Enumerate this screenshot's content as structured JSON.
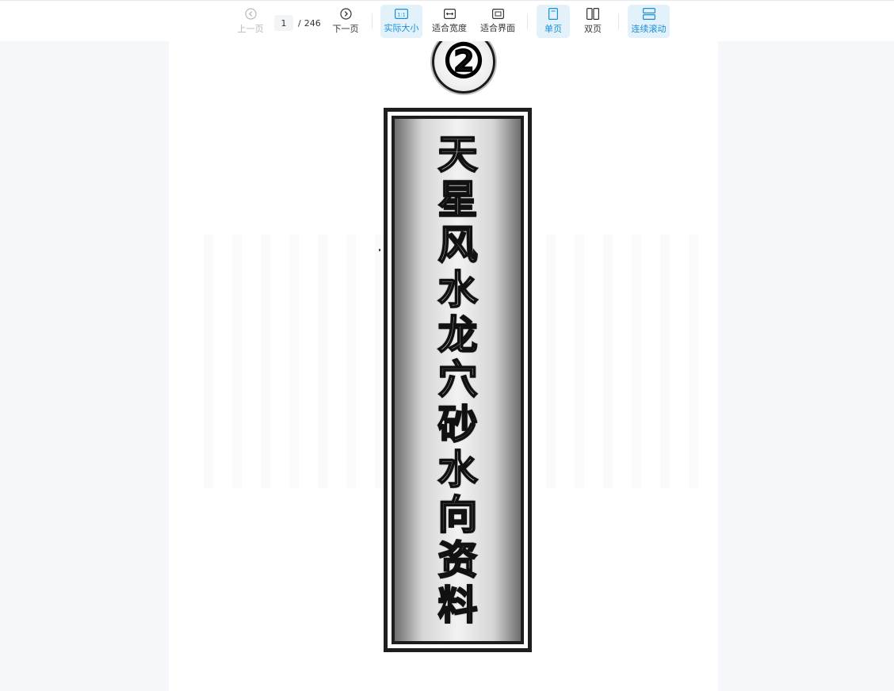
{
  "toolbar": {
    "prev_label": "上一页",
    "next_label": "下一页",
    "current_page": "1",
    "page_separator": "/",
    "total_pages": "246",
    "actual_size_icon_text": "1:1",
    "actual_size_label": "实际大小",
    "fit_width_label": "适合宽度",
    "fit_page_label": "适合界面",
    "single_page_label": "单页",
    "double_page_label": "双页",
    "continuous_scroll_label": "连续滚动",
    "accent_color": "#1a8fd6",
    "active_bg_color": "#e3f1fb",
    "icons": {
      "prev": "chevron-left-circle-icon",
      "next": "chevron-right-circle-icon",
      "actual_size": "one-to-one-icon",
      "fit_width": "fit-width-icon",
      "fit_page": "fit-page-icon",
      "single_page": "single-page-icon",
      "double_page": "double-page-icon",
      "continuous_scroll": "continuous-scroll-icon"
    }
  },
  "document": {
    "circled_number": "②",
    "title_characters": [
      "天",
      "星",
      "风",
      "水",
      "龙",
      "穴",
      "砂",
      "水",
      "向",
      "资",
      "料"
    ]
  }
}
